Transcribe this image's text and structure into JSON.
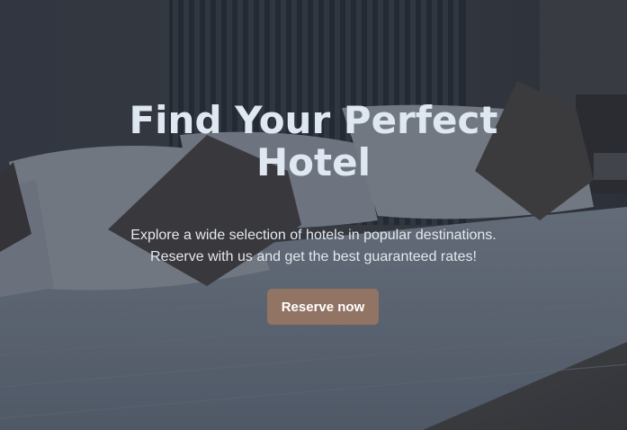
{
  "hero": {
    "image": "hotel-bedroom-photo",
    "title_line1": "Find Your Perfect",
    "title_line2": "Hotel",
    "subtitle_line1": "Explore a wide selection of hotels in popular destinations.",
    "subtitle_line2": "Reserve with us and get the best guaranteed rates!",
    "cta_label": "Reserve now"
  },
  "colors": {
    "overlay": "#1e2634",
    "title": "#dfe7f1",
    "button": "#917463"
  }
}
